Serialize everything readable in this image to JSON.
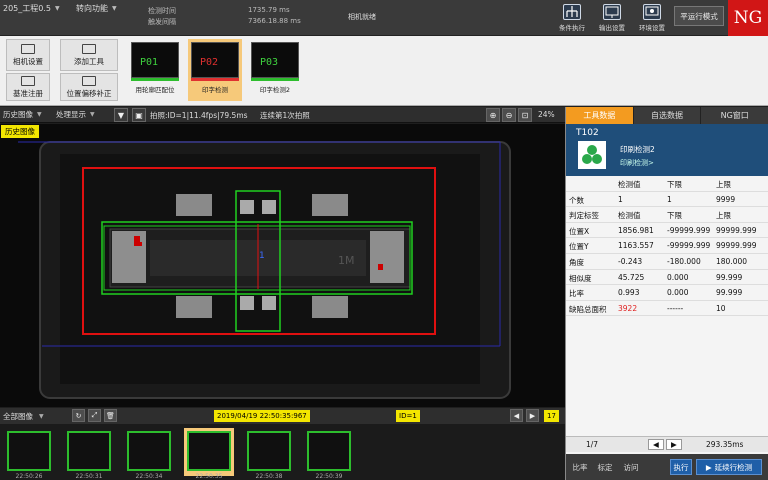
{
  "topbar": {
    "project_select": "205_工程0.5",
    "function_select": "转向功能",
    "info_labels": [
      "检测时间",
      "触发间隔"
    ],
    "info_values": [
      "1735.79 ms",
      "7366.18.88 ms"
    ],
    "camera_status": "相机就绪",
    "buttons": [
      {
        "label": "条件执行",
        "icon": "flow-icon"
      },
      {
        "label": "输出设置",
        "icon": "output-icon"
      },
      {
        "label": "环境设置",
        "icon": "monitor-icon"
      }
    ],
    "run_mode": "平运行模式",
    "result": "NG"
  },
  "toolrow": {
    "buttons": [
      "相机设置",
      "添加工具",
      "基准注册",
      "位置偏移补正"
    ],
    "tools": [
      {
        "code": "P01",
        "name": "用轮廓匹配位",
        "code_color": "#3fd23f",
        "bar_color": "#2dbd2d",
        "active": false
      },
      {
        "code": "P02",
        "name": "印字检测",
        "code_color": "#e03030",
        "bar_color": "#e03030",
        "active": true
      },
      {
        "code": "P03",
        "name": "印字检测2",
        "code_color": "#3fd23f",
        "bar_color": "#2dbd2d",
        "active": false
      }
    ]
  },
  "viewbar": {
    "history_select": "历史图像",
    "process_select": "处理显示",
    "status_text": "拍照:ID=1|11.4fps|79.5ms",
    "capture_mode": "连续第1次拍照",
    "zoom_level": "24%",
    "history_tag": "历史图像"
  },
  "canvas": {
    "label_1": "1",
    "marking_text": "1M"
  },
  "filmbar": {
    "all_images_select": "全部图像",
    "timestamp": "2019/04/19 22:50:35:967",
    "id_tag": "ID=1",
    "count_tag": "17"
  },
  "filmstrip": {
    "frames": [
      {
        "caption": "22:50:26",
        "active": false
      },
      {
        "caption": "22:50:31",
        "active": false
      },
      {
        "caption": "22:50:34",
        "active": false
      },
      {
        "caption": "22:50:35",
        "active": true
      },
      {
        "caption": "22:50:38",
        "active": false
      },
      {
        "caption": "22:50:39",
        "active": false
      }
    ]
  },
  "rpanel": {
    "tabs": [
      "工具数据",
      "自选数据",
      "NG窗口"
    ],
    "tool_id": "T102",
    "tool_name": "印刷检测2",
    "tool_sub": "印刷检测>",
    "rows": [
      [
        "",
        "检测值",
        "下限",
        "上限"
      ],
      [
        "个数",
        "1",
        "1",
        "9999"
      ],
      [
        "判定标签",
        "检测值",
        "下限",
        "上限"
      ],
      [
        "位置X",
        "1856.981",
        "-99999.999",
        "99999.999"
      ],
      [
        "位置Y",
        "1163.557",
        "-99999.999",
        "99999.999"
      ],
      [
        "角度",
        "-0.243",
        "-180.000",
        "180.000"
      ],
      [
        "相似度",
        "45.725",
        "0.000",
        "99.999"
      ],
      [
        "比率",
        "0.993",
        "0.000",
        "99.999"
      ],
      [
        "缺陷总面积",
        "3922",
        "------",
        "10"
      ]
    ],
    "defect_value_color": "#e02020",
    "page_index": "1/7",
    "elapsed": "293.35ms",
    "bottom_buttons": [
      "比率",
      "标定",
      "访问"
    ],
    "exec_button": "执行",
    "stop_button": "延续行检测"
  },
  "colors": {
    "ng_red": "#d11616",
    "accent_orange": "#f39b20",
    "ok_green": "#2dbd2d",
    "tool_header_blue": "#1f4e7a",
    "highlight_yellow": "#f3e600"
  }
}
